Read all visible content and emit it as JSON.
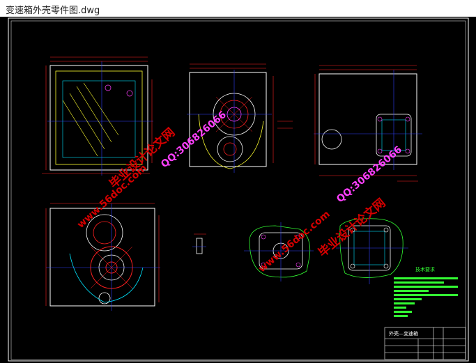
{
  "window": {
    "title": "变速箱外壳零件图.dwg"
  },
  "watermarks": [
    {
      "id": "wm1-cn",
      "text": "毕业设计论文网"
    },
    {
      "id": "wm1-url",
      "text": "www.56doc.com"
    },
    {
      "id": "wm1-qq",
      "text": "QQ:306826066"
    },
    {
      "id": "wm2-cn",
      "text": "毕业设计论文网"
    },
    {
      "id": "wm2-url",
      "text": "www.56doc.com"
    },
    {
      "id": "wm2-qq",
      "text": "QQ:306826066"
    }
  ],
  "tech_requirements": {
    "title": "技术要求"
  },
  "title_block": {
    "part_name": "外壳—变速箱"
  },
  "colors": {
    "background": "#000000",
    "outline": "#ffffff",
    "dimension": "#ff2020",
    "center": "#3040ff",
    "hatch": "#ffff30",
    "section": "#00e5ff",
    "text_green": "#33ff33",
    "magenta": "#ff40ff"
  }
}
